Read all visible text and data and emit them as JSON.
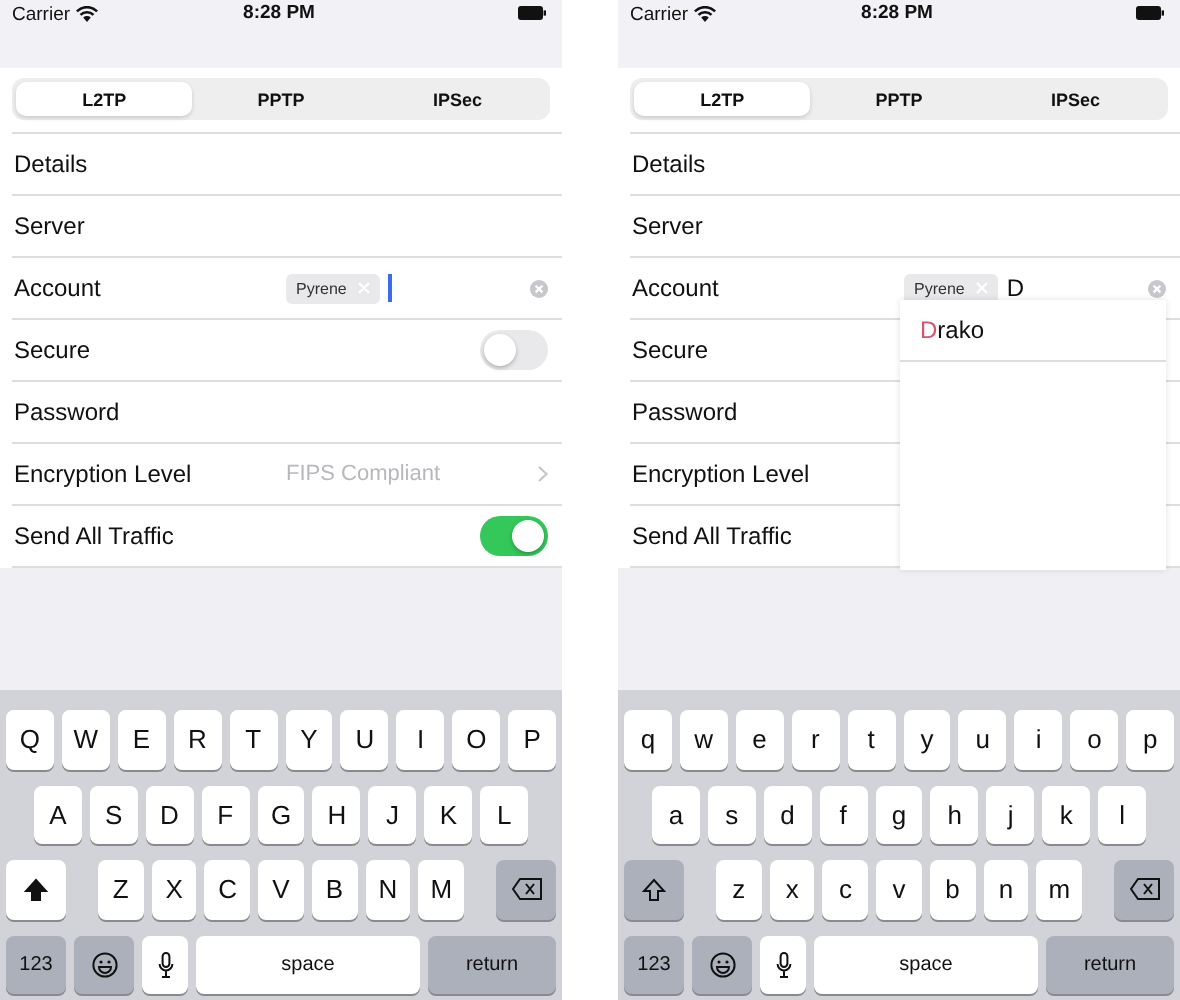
{
  "screens": [
    {
      "status": {
        "carrier": "Carrier",
        "time": "8:28 PM"
      },
      "tabs": [
        {
          "label": "L2TP",
          "selected": true
        },
        {
          "label": "PPTP",
          "selected": false
        },
        {
          "label": "IPSec",
          "selected": false
        }
      ],
      "rows": [
        {
          "kind": "plain",
          "label": "Details"
        },
        {
          "kind": "plain",
          "label": "Server"
        },
        {
          "kind": "tokens",
          "label": "Account",
          "tokens": [
            "Pyrene"
          ],
          "text": ""
        },
        {
          "kind": "toggle",
          "label": "Secure",
          "on": false
        },
        {
          "kind": "plain",
          "label": "Password"
        },
        {
          "kind": "value",
          "label": "Encryption Level",
          "value": "FIPS Compliant"
        },
        {
          "kind": "toggle",
          "label": "Send All Traffic",
          "on": true
        }
      ],
      "keyboard": {
        "shift_on": true,
        "rows": [
          [
            "Q",
            "W",
            "E",
            "R",
            "T",
            "Y",
            "U",
            "I",
            "O",
            "P"
          ],
          [
            "A",
            "S",
            "D",
            "F",
            "G",
            "H",
            "J",
            "K",
            "L"
          ],
          [
            "Z",
            "X",
            "C",
            "V",
            "B",
            "N",
            "M"
          ]
        ],
        "numbers": "123",
        "space": "space",
        "return": "return"
      }
    },
    {
      "status": {
        "carrier": "Carrier",
        "time": "8:28 PM"
      },
      "tabs": [
        {
          "label": "L2TP",
          "selected": true
        },
        {
          "label": "PPTP",
          "selected": false
        },
        {
          "label": "IPSec",
          "selected": false
        }
      ],
      "rows": [
        {
          "kind": "plain",
          "label": "Details"
        },
        {
          "kind": "plain",
          "label": "Server"
        },
        {
          "kind": "tokens",
          "label": "Account",
          "tokens": [
            "Pyrene"
          ],
          "text": "D"
        },
        {
          "kind": "plain",
          "label": "Secure"
        },
        {
          "kind": "plain",
          "label": "Password"
        },
        {
          "kind": "plain",
          "label": "Encryption Level"
        },
        {
          "kind": "plain",
          "label": "Send All Traffic"
        }
      ],
      "suggestions": [
        {
          "match": "D",
          "rest": "rako"
        }
      ],
      "keyboard": {
        "shift_on": false,
        "rows": [
          [
            "q",
            "w",
            "e",
            "r",
            "t",
            "y",
            "u",
            "i",
            "o",
            "p"
          ],
          [
            "a",
            "s",
            "d",
            "f",
            "g",
            "h",
            "j",
            "k",
            "l"
          ],
          [
            "z",
            "x",
            "c",
            "v",
            "b",
            "n",
            "m"
          ]
        ],
        "numbers": "123",
        "space": "space",
        "return": "return"
      }
    }
  ]
}
